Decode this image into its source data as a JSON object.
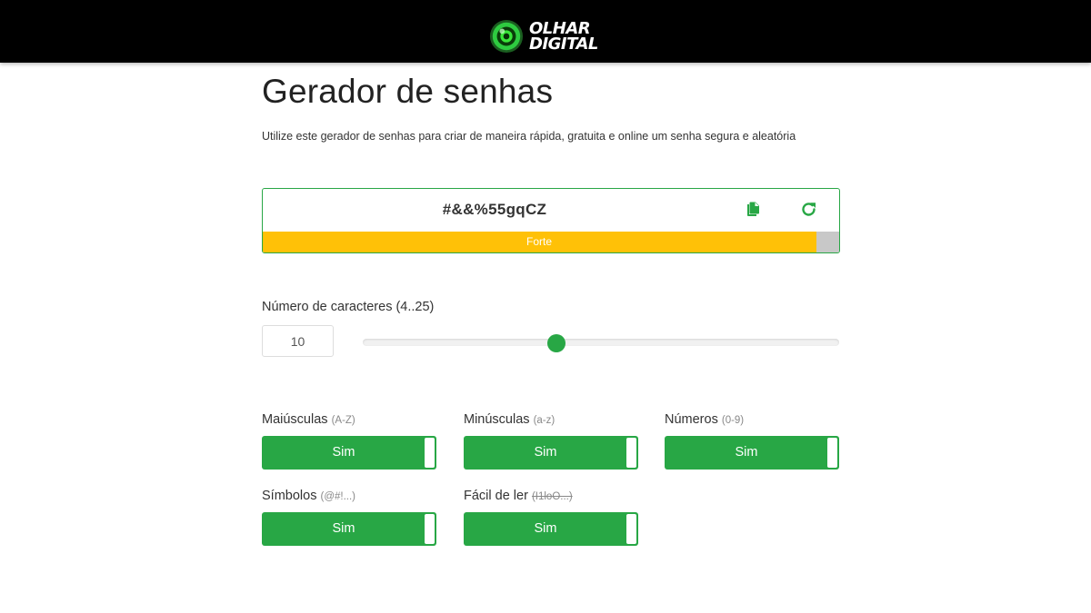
{
  "header": {
    "logo_line1": "OLHAR",
    "logo_line2": "DIGITAL",
    "logo_icon": "green-eye-logo-icon"
  },
  "page": {
    "title": "Gerador de senhas",
    "subtitle": "Utilize este gerador de senhas para criar de maneira rápida, gratuita e online um senha segura e aleatória"
  },
  "password": {
    "value": "#&&%55gqCZ",
    "copy_icon": "copy-icon",
    "refresh_icon": "refresh-icon",
    "strength_label": "Forte",
    "strength_fraction": 0.96,
    "strength_color": "#ffc107"
  },
  "length": {
    "label": "Número de caracteres (4..25)",
    "value": "10",
    "min": 4,
    "max": 25,
    "slider_value": 10
  },
  "options": [
    {
      "label": "Maiúsculas",
      "hint": "(A-Z)",
      "state": "Sim"
    },
    {
      "label": "Minúsculas",
      "hint": "(a-z)",
      "state": "Sim"
    },
    {
      "label": "Números",
      "hint": "(0-9)",
      "state": "Sim"
    },
    {
      "label": "Símbolos",
      "hint": "(@#!...)",
      "state": "Sim"
    },
    {
      "label": "Fácil de ler",
      "hint": "(I1loO...)",
      "state": "Sim"
    }
  ],
  "colors": {
    "accent": "#28a745",
    "header_bg": "#000000"
  }
}
